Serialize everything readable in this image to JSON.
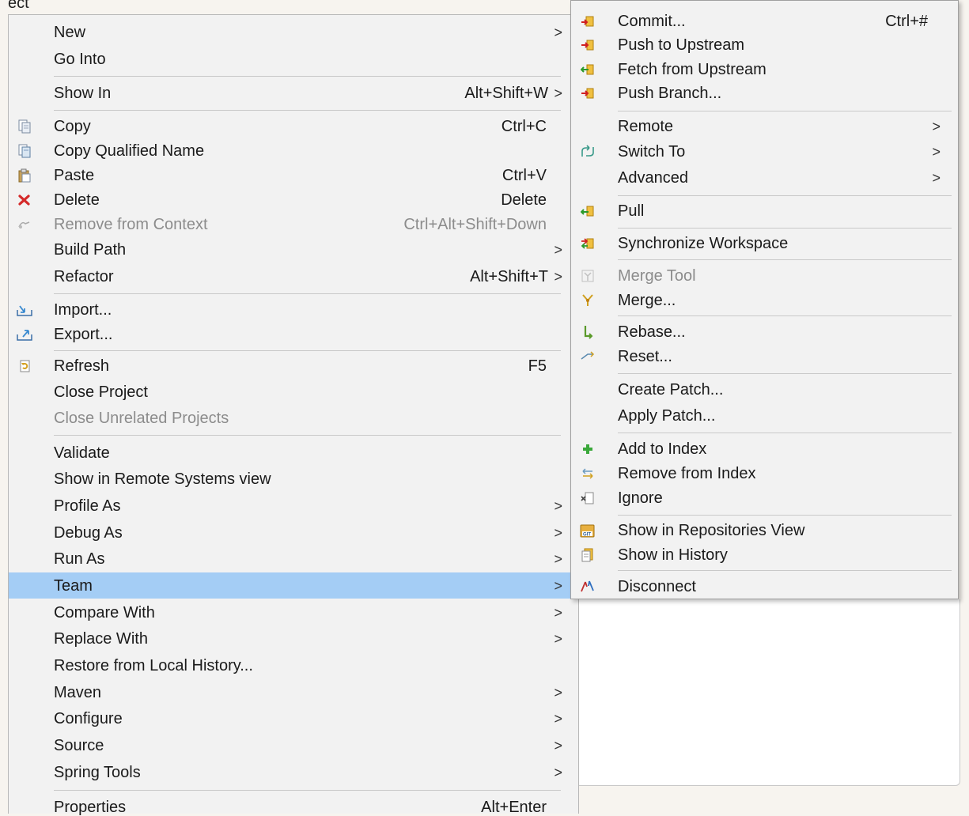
{
  "top_fragment": "ect",
  "main_menu": {
    "items": [
      {
        "label": "New",
        "shortcut": "",
        "submenu": true
      },
      {
        "label": "Go Into",
        "shortcut": "",
        "submenu": false
      },
      {
        "label": "Show In",
        "shortcut": "Alt+Shift+W",
        "submenu": true
      },
      {
        "label": "Copy",
        "shortcut": "Ctrl+C",
        "submenu": false,
        "icon": "copy-icon"
      },
      {
        "label": "Copy Qualified Name",
        "shortcut": "",
        "submenu": false,
        "icon": "copy-qualified-name-icon"
      },
      {
        "label": "Paste",
        "shortcut": "Ctrl+V",
        "submenu": false,
        "icon": "paste-icon"
      },
      {
        "label": "Delete",
        "shortcut": "Delete",
        "submenu": false,
        "icon": "delete-icon"
      },
      {
        "label": "Remove from Context",
        "shortcut": "Ctrl+Alt+Shift+Down",
        "submenu": false,
        "disabled": true,
        "icon": "remove-context-icon"
      },
      {
        "label": "Build Path",
        "shortcut": "",
        "submenu": true
      },
      {
        "label": "Refactor",
        "shortcut": "Alt+Shift+T",
        "submenu": true
      },
      {
        "label": "Import...",
        "shortcut": "",
        "submenu": false,
        "icon": "import-icon"
      },
      {
        "label": "Export...",
        "shortcut": "",
        "submenu": false,
        "icon": "export-icon"
      },
      {
        "label": "Refresh",
        "shortcut": "F5",
        "submenu": false,
        "icon": "refresh-icon"
      },
      {
        "label": "Close Project",
        "shortcut": "",
        "submenu": false
      },
      {
        "label": "Close Unrelated Projects",
        "shortcut": "",
        "submenu": false,
        "disabled": true
      },
      {
        "label": "Validate",
        "shortcut": "",
        "submenu": false
      },
      {
        "label": "Show in Remote Systems view",
        "shortcut": "",
        "submenu": false
      },
      {
        "label": "Profile As",
        "shortcut": "",
        "submenu": true
      },
      {
        "label": "Debug As",
        "shortcut": "",
        "submenu": true
      },
      {
        "label": "Run As",
        "shortcut": "",
        "submenu": true
      },
      {
        "label": "Team",
        "shortcut": "",
        "submenu": true,
        "highlighted": true
      },
      {
        "label": "Compare With",
        "shortcut": "",
        "submenu": true
      },
      {
        "label": "Replace With",
        "shortcut": "",
        "submenu": true
      },
      {
        "label": "Restore from Local History...",
        "shortcut": "",
        "submenu": false
      },
      {
        "label": "Maven",
        "shortcut": "",
        "submenu": true
      },
      {
        "label": "Configure",
        "shortcut": "",
        "submenu": true
      },
      {
        "label": "Source",
        "shortcut": "",
        "submenu": true
      },
      {
        "label": "Spring Tools",
        "shortcut": "",
        "submenu": true
      },
      {
        "label": "Properties",
        "shortcut": "Alt+Enter",
        "submenu": false
      }
    ]
  },
  "team_menu": {
    "items": [
      {
        "label": "Commit...",
        "shortcut": "Ctrl+#",
        "submenu": false,
        "icon": "commit-icon"
      },
      {
        "label": "Push to Upstream",
        "shortcut": "",
        "submenu": false,
        "icon": "push-upstream-icon"
      },
      {
        "label": "Fetch from Upstream",
        "shortcut": "",
        "submenu": false,
        "icon": "fetch-upstream-icon"
      },
      {
        "label": "Push Branch...",
        "shortcut": "",
        "submenu": false,
        "icon": "push-branch-icon"
      },
      {
        "label": "Remote",
        "shortcut": "",
        "submenu": true
      },
      {
        "label": "Switch To",
        "shortcut": "",
        "submenu": true,
        "icon": "switch-to-icon"
      },
      {
        "label": "Advanced",
        "shortcut": "",
        "submenu": true
      },
      {
        "label": "Pull",
        "shortcut": "",
        "submenu": false,
        "icon": "pull-icon"
      },
      {
        "label": "Synchronize Workspace",
        "shortcut": "",
        "submenu": false,
        "icon": "synchronize-icon"
      },
      {
        "label": "Merge Tool",
        "shortcut": "",
        "submenu": false,
        "disabled": true,
        "icon": "merge-tool-icon"
      },
      {
        "label": "Merge...",
        "shortcut": "",
        "submenu": false,
        "icon": "merge-icon"
      },
      {
        "label": "Rebase...",
        "shortcut": "",
        "submenu": false,
        "icon": "rebase-icon"
      },
      {
        "label": "Reset...",
        "shortcut": "",
        "submenu": false,
        "icon": "reset-icon"
      },
      {
        "label": "Create Patch...",
        "shortcut": "",
        "submenu": false
      },
      {
        "label": "Apply Patch...",
        "shortcut": "",
        "submenu": false
      },
      {
        "label": "Add to Index",
        "shortcut": "",
        "submenu": false,
        "icon": "add-to-index-icon"
      },
      {
        "label": "Remove from Index",
        "shortcut": "",
        "submenu": false,
        "icon": "remove-from-index-icon"
      },
      {
        "label": "Ignore",
        "shortcut": "",
        "submenu": false,
        "icon": "ignore-icon"
      },
      {
        "label": "Show in Repositories View",
        "shortcut": "",
        "submenu": false,
        "icon": "repositories-view-icon"
      },
      {
        "label": "Show in History",
        "shortcut": "",
        "submenu": false,
        "icon": "history-icon"
      },
      {
        "label": "Disconnect",
        "shortcut": "",
        "submenu": false,
        "icon": "disconnect-icon"
      }
    ]
  },
  "submenu_arrow": ">",
  "colors": {
    "highlight": "#a4cdf5",
    "menu_bg": "#f2f2f2",
    "disabled_text": "#8c8c8c"
  }
}
